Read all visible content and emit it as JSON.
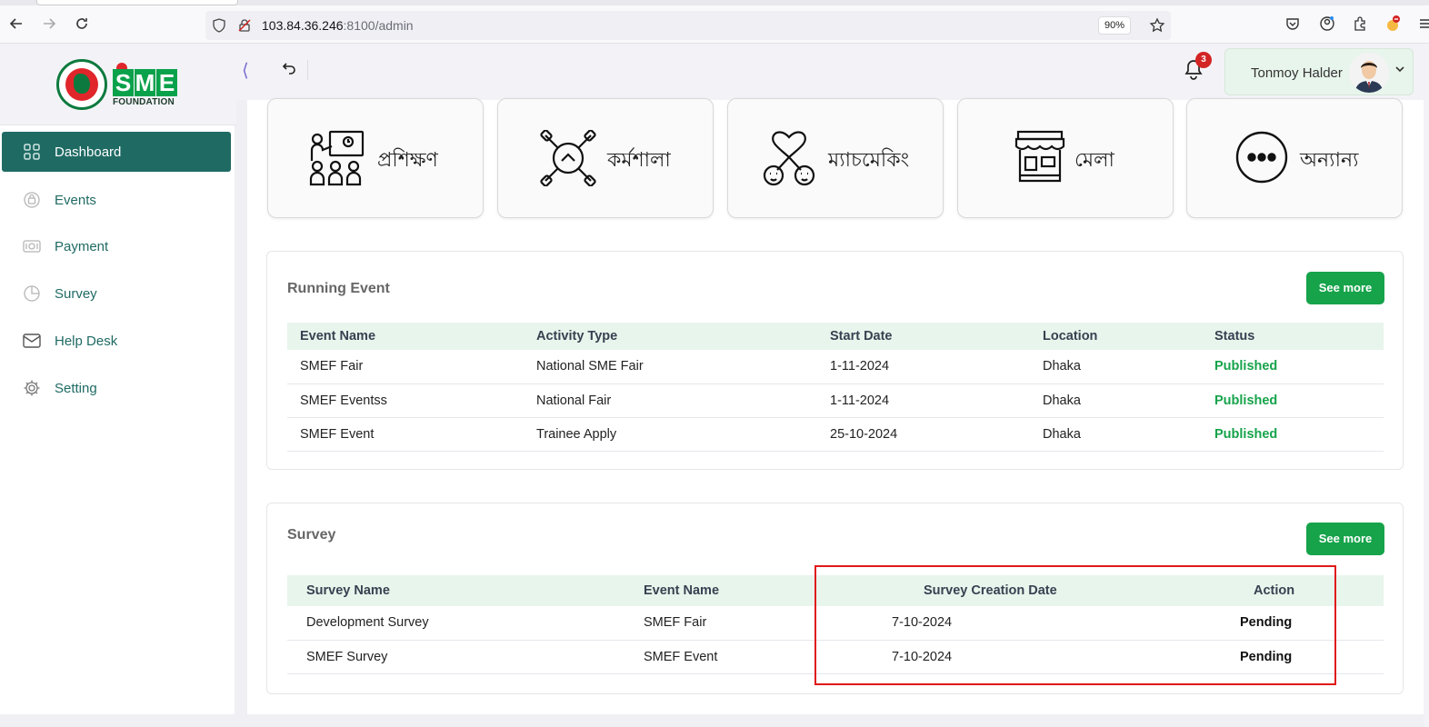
{
  "browser": {
    "url_host": "103.84.36.246",
    "url_rest": ":8100/admin",
    "zoom": "90%"
  },
  "header": {
    "logo_text": "SME",
    "logo_sub": "FOUNDATION",
    "notification_count": "3",
    "user_name": "Tonmoy Halder"
  },
  "sidebar": {
    "items": [
      {
        "label": "Dashboard",
        "icon": "grid-icon",
        "active": true
      },
      {
        "label": "Events",
        "icon": "events-icon"
      },
      {
        "label": "Payment",
        "icon": "payment-icon"
      },
      {
        "label": "Survey",
        "icon": "pie-icon"
      },
      {
        "label": "Help Desk",
        "icon": "mail-icon"
      },
      {
        "label": "Setting",
        "icon": "gear-icon"
      }
    ]
  },
  "categories": [
    {
      "label": "প্রশিক্ষণ",
      "icon": "training-icon"
    },
    {
      "label": "কর্মশালা",
      "icon": "workshop-icon"
    },
    {
      "label": "ম্যাচমেকিং",
      "icon": "matchmaking-icon"
    },
    {
      "label": "মেলা",
      "icon": "fair-stall-icon"
    },
    {
      "label": "অন্যান্য",
      "icon": "more-icon"
    }
  ],
  "running_event": {
    "title": "Running Event",
    "see_more": "See more",
    "columns": [
      "Event Name",
      "Activity Type",
      "Start Date",
      "Location",
      "Status"
    ],
    "rows": [
      [
        "SMEF Fair",
        "National SME Fair",
        "1-11-2024",
        "Dhaka",
        "Published"
      ],
      [
        "SMEF Eventss",
        "National Fair",
        "1-11-2024",
        "Dhaka",
        "Published"
      ],
      [
        "SMEF Event",
        "Trainee Apply",
        "25-10-2024",
        "Dhaka",
        "Published"
      ]
    ]
  },
  "survey": {
    "title": "Survey",
    "see_more": "See more",
    "columns": [
      "Survey Name",
      "Event Name",
      "Survey Creation Date",
      "Action"
    ],
    "rows": [
      [
        "Development Survey",
        "SMEF Fair",
        "7-10-2024",
        "Pending"
      ],
      [
        "SMEF Survey",
        "SMEF Event",
        "7-10-2024",
        "Pending"
      ]
    ]
  },
  "colors": {
    "brand_teal": "#1f6b64",
    "brand_green": "#16a34a",
    "highlight_red": "#e01919"
  }
}
